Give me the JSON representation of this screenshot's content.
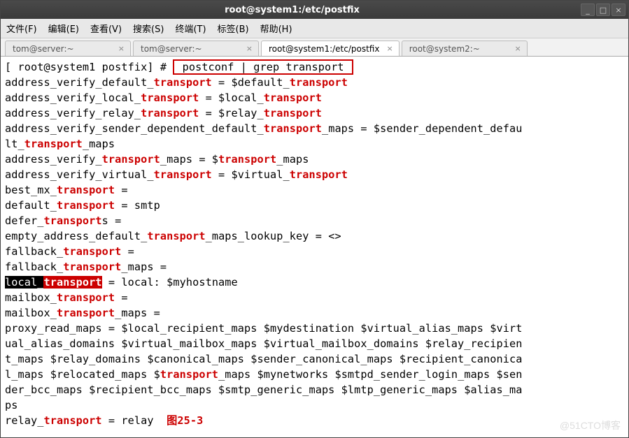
{
  "titlebar": {
    "title": "root@system1:/etc/postfix"
  },
  "menu": {
    "file": "文件(F)",
    "edit": "编辑(E)",
    "view": "查看(V)",
    "search": "搜索(S)",
    "terminal": "终端(T)",
    "tabs": "标签(B)",
    "help": "帮助(H)"
  },
  "tabs": [
    {
      "label": "tom@server:~",
      "active": false
    },
    {
      "label": "tom@server:~",
      "active": false
    },
    {
      "label": "root@system1:/etc/postfix",
      "active": true
    },
    {
      "label": "root@system2:~",
      "active": false
    }
  ],
  "prompt": "[ root@system1 postfix] # ",
  "command_boxed": " postconf | grep transport ",
  "watermark": "@51CTO博客",
  "figure_label": "图25-3",
  "lines": {
    "l1a": "address_verify_default_",
    "l1b": "transport",
    "l1c": " = $default_",
    "l1d": "transport",
    "l2a": "address_verify_local_",
    "l2b": "transport",
    "l2c": " = $local_",
    "l2d": "transport",
    "l3a": "address_verify_relay_",
    "l3b": "transport",
    "l3c": " = $relay_",
    "l3d": "transport",
    "l4a": "address_verify_sender_dependent_default_",
    "l4b": "transport",
    "l4c": "_maps = $sender_dependent_defau",
    "l5a": "lt_",
    "l5b": "transport",
    "l5c": "_maps",
    "l6a": "address_verify_",
    "l6b": "transport",
    "l6c": "_maps = $",
    "l6d": "transport",
    "l6e": "_maps",
    "l7a": "address_verify_virtual_",
    "l7b": "transport",
    "l7c": " = $virtual_",
    "l7d": "transport",
    "l8a": "best_mx_",
    "l8b": "transport",
    "l8c": " =",
    "l9a": "default_",
    "l9b": "transport",
    "l9c": " = smtp",
    "l10a": "defer_",
    "l10b": "transport",
    "l10c": "s =",
    "l11a": "empty_address_default_",
    "l11b": "transport",
    "l11c": "_maps_lookup_key = <>",
    "l12a": "fallback_",
    "l12b": "transport",
    "l12c": " =",
    "l13a": "fallback_",
    "l13b": "transport",
    "l13c": "_maps =",
    "l14a": "local_",
    "l14b": "transport",
    "l14c": " = local: $myhostname",
    "l15a": "mailbox_",
    "l15b": "transport",
    "l15c": " =",
    "l16a": "mailbox_",
    "l16b": "transport",
    "l16c": "_maps =",
    "l17": "proxy_read_maps = $local_recipient_maps $mydestination $virtual_alias_maps $virt",
    "l18": "ual_alias_domains $virtual_mailbox_maps $virtual_mailbox_domains $relay_recipien",
    "l19": "t_maps $relay_domains $canonical_maps $sender_canonical_maps $recipient_canonica",
    "l20a": "l_maps $relocated_maps $",
    "l20b": "transport",
    "l20c": "_maps $mynetworks $smtpd_sender_login_maps $sen",
    "l21": "der_bcc_maps $recipient_bcc_maps $smtp_generic_maps $lmtp_generic_maps $alias_ma",
    "l22": "ps",
    "l23a": "relay_",
    "l23b": "transport",
    "l23c": " = relay"
  }
}
